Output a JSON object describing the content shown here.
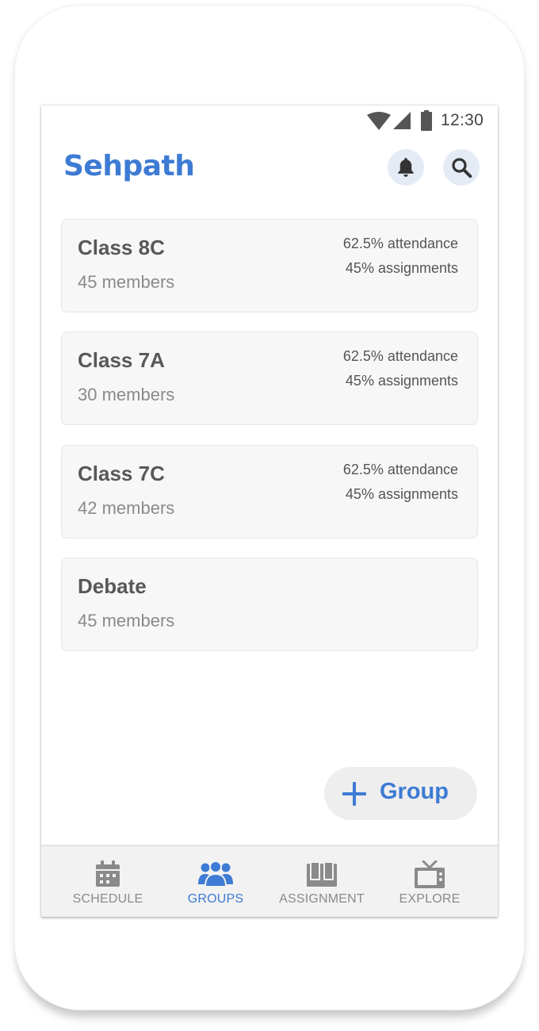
{
  "status_bar": {
    "time": "12:30"
  },
  "header": {
    "app_title": "Sehpath"
  },
  "groups": [
    {
      "name": "Class 8C",
      "members": "45 members",
      "attendance": "62.5% attendance",
      "assignments": "45% assignments"
    },
    {
      "name": "Class 7A",
      "members": "30 members",
      "attendance": "62.5% attendance",
      "assignments": "45% assignments"
    },
    {
      "name": "Class 7C",
      "members": "42 members",
      "attendance": "62.5% attendance",
      "assignments": "45% assignments"
    },
    {
      "name": "Debate",
      "members": "45 members",
      "attendance": "",
      "assignments": ""
    }
  ],
  "fab": {
    "label": "Group",
    "icon": "plus-icon"
  },
  "bottom_nav": {
    "active": "groups",
    "items": [
      {
        "key": "schedule",
        "label": "SCHEDULE",
        "icon": "calendar-icon"
      },
      {
        "key": "groups",
        "label": "GROUPS",
        "icon": "people-icon"
      },
      {
        "key": "assignment",
        "label": "ASSIGNMENT",
        "icon": "book-icon"
      },
      {
        "key": "explore",
        "label": "EXPLORE",
        "icon": "tv-icon"
      }
    ]
  },
  "colors": {
    "accent": "#3d7bd4",
    "card_bg": "#f7f7f7",
    "icon_gray": "#8a8a8a",
    "header_button_bg": "#e4ebf5"
  }
}
